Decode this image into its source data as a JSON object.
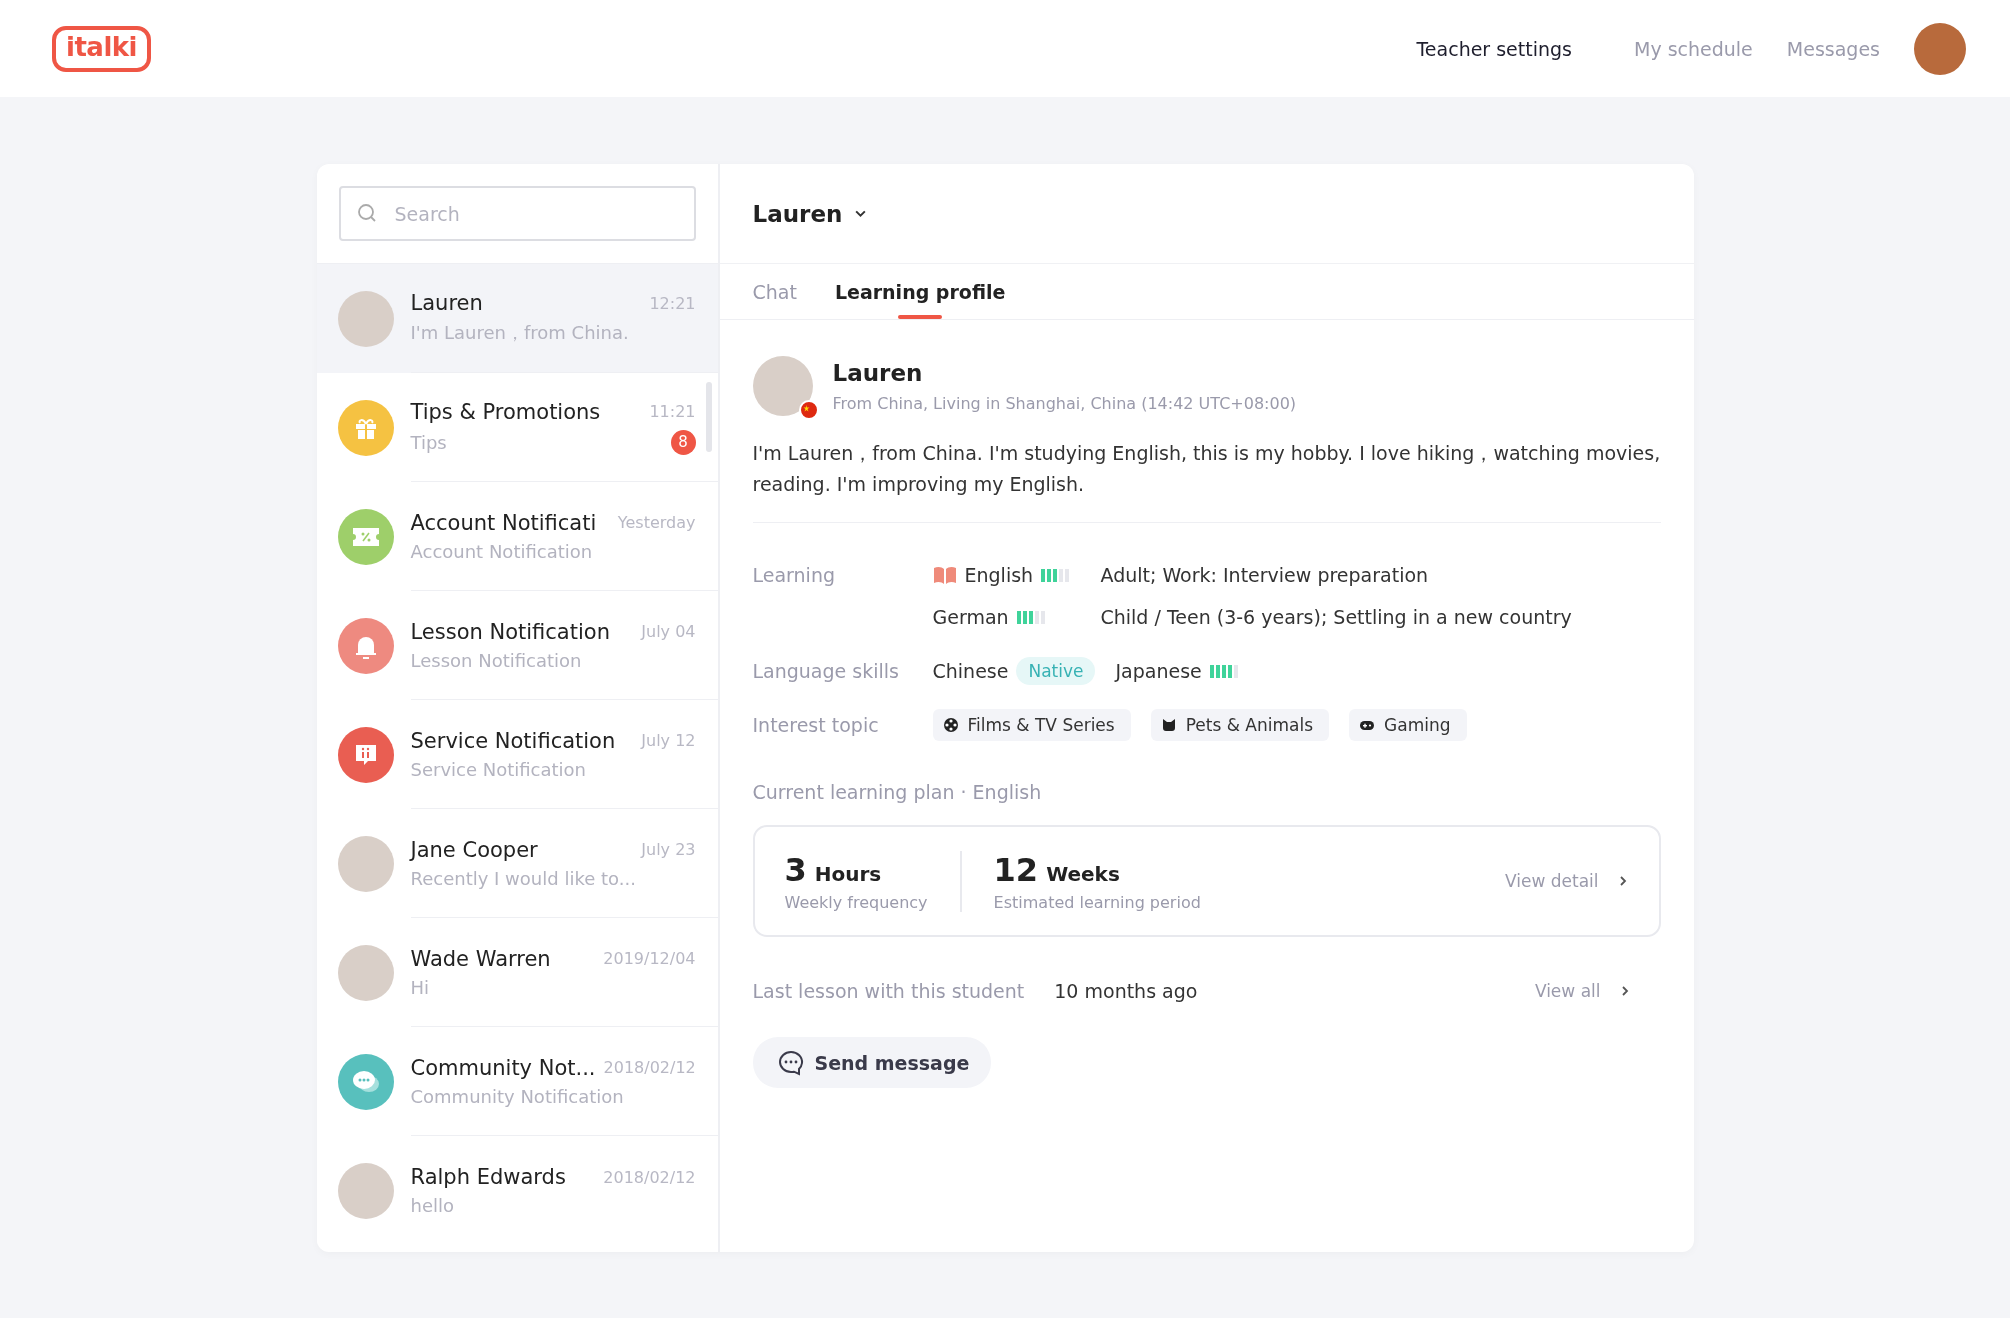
{
  "header": {
    "logo": "italki",
    "nav": [
      {
        "label": "Teacher settings",
        "selected": true
      },
      {
        "label": "My schedule",
        "selected": false
      },
      {
        "label": "Messages",
        "selected": false
      }
    ]
  },
  "sidebar": {
    "search": {
      "placeholder": "Search"
    },
    "conversations": [
      {
        "name": "Lauren",
        "preview": "I'm Lauren，from China.",
        "time": "12:21",
        "kind": "person",
        "selected": true
      },
      {
        "name": "Tips & Promotions",
        "preview": "Tips",
        "time": "11:21",
        "badge": "8",
        "kind": "gift",
        "color": "#f5c242",
        "selected": false
      },
      {
        "name": "Account Notificati",
        "preview": "Account Notification",
        "time": "Yesterday",
        "kind": "ticket",
        "color": "#9ecf6a",
        "selected": false
      },
      {
        "name": "Lesson Notification",
        "preview": "Lesson Notification",
        "time": "July 04",
        "kind": "bell",
        "color": "#ee8a80",
        "selected": false
      },
      {
        "name": "Service Notification",
        "preview": "Service Notification",
        "time": "July 12",
        "kind": "alert",
        "color": "#e95e52",
        "selected": false
      },
      {
        "name": "Jane Cooper",
        "preview": "Recently I would like to...",
        "time": "July 23",
        "kind": "person",
        "selected": false
      },
      {
        "name": "Wade Warren",
        "preview": "Hi",
        "time": "2019/12/04",
        "kind": "person",
        "selected": false
      },
      {
        "name": "Community Not...",
        "preview": "Community Notification",
        "time": "2018/02/12",
        "kind": "chat",
        "color": "#58c0bd",
        "selected": false
      },
      {
        "name": "Ralph Edwards",
        "preview": "hello",
        "time": "2018/02/12",
        "kind": "person",
        "selected": false
      }
    ]
  },
  "conversation": {
    "title": "Lauren",
    "tabs": [
      {
        "label": "Chat",
        "selected": false
      },
      {
        "label": "Learning profile",
        "selected": true
      }
    ],
    "profile": {
      "name": "Lauren",
      "location": "From China, Living in Shanghai, China (14:42 UTC+08:00)",
      "bio": "I'm Lauren，from China. I'm studying English, this is my hobby. I love hiking，watching movies, reading.  I'm improving my English.",
      "learning_label": "Learning",
      "learning": [
        {
          "language": "English",
          "level": 0.6,
          "goals": "Adult; Work: Interview preparation",
          "kind": "book"
        },
        {
          "language": "German",
          "level": 0.6,
          "goals": "Child / Teen (3-6 years); Settling in a new country",
          "kind": "plain"
        }
      ],
      "skills_label": "Language skills",
      "skills": [
        {
          "language": "Chinese",
          "tag": "Native",
          "kind": "native"
        },
        {
          "language": "Japanese",
          "level": 0.8,
          "kind": "meter"
        }
      ],
      "topics_label": "Interest topic",
      "topics": [
        {
          "label": "Films & TV Series",
          "kind": "film"
        },
        {
          "label": "Pets & Animals",
          "kind": "pet"
        },
        {
          "label": "Gaming",
          "kind": "game"
        }
      ],
      "plan_heading": "Current learning plan · English",
      "plan": {
        "stats": [
          {
            "value": "3",
            "unit": "Hours",
            "caption": "Weekly frequency"
          },
          {
            "value": "12",
            "unit": "Weeks",
            "caption": "Estimated learning period"
          }
        ],
        "link": "View detail"
      },
      "last_lesson": {
        "label": "Last lesson with this student",
        "value": "10 months ago",
        "link": "View all"
      },
      "button": "Send message"
    }
  }
}
